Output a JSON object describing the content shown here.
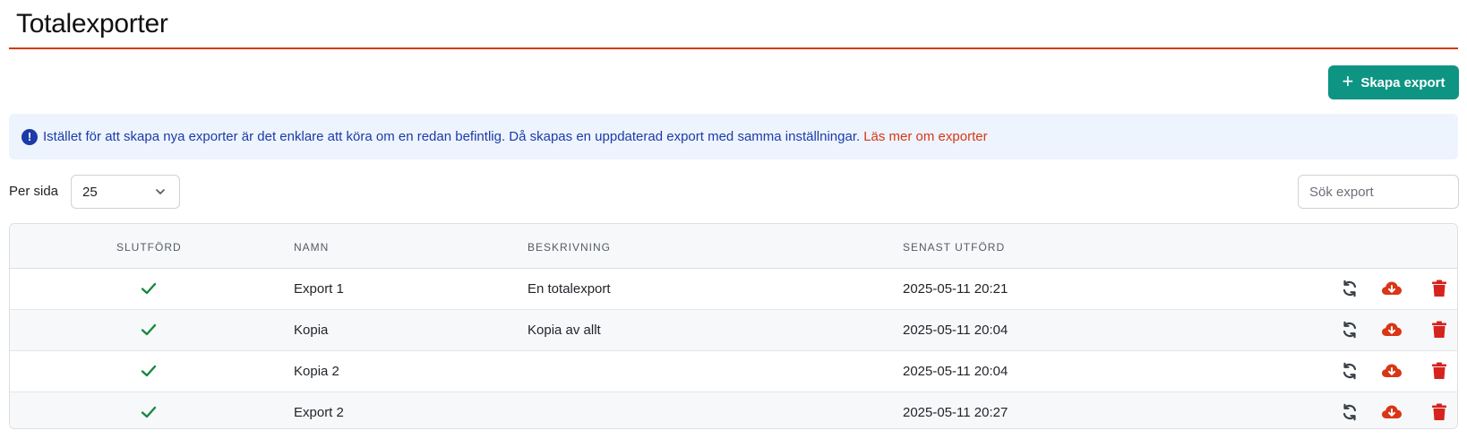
{
  "header": {
    "title": "Totalexporter"
  },
  "toolbar": {
    "create_label": "Skapa export"
  },
  "info": {
    "message": "Istället för att skapa nya exporter är det enklare att köra om en redan befintlig. Då skapas en uppdaterad export med samma inställningar.",
    "link_label": "Läs mer om exporter"
  },
  "controls": {
    "per_page_label": "Per sida",
    "per_page_value": "25",
    "search_placeholder": "Sök export"
  },
  "table": {
    "columns": {
      "completed": "SLUTFÖRD",
      "name": "NAMN",
      "description": "BESKRIVNING",
      "last_run": "SENAST UTFÖRD"
    },
    "rows": [
      {
        "name": "Export 1",
        "description": "En totalexport",
        "last_run": "2025-05-11 20:21",
        "completed": true
      },
      {
        "name": "Kopia",
        "description": "Kopia av allt",
        "last_run": "2025-05-11 20:04",
        "completed": true
      },
      {
        "name": "Kopia 2",
        "description": "",
        "last_run": "2025-05-11 20:04",
        "completed": true
      },
      {
        "name": "Export 2",
        "description": "",
        "last_run": "2025-05-11 20:27",
        "completed": true
      }
    ]
  },
  "colors": {
    "accent": "#0e9483",
    "title_rule": "#d93616",
    "info_text": "#1c3ba8",
    "info_bg": "#edf4fe",
    "check": "#16883f",
    "download": "#d93616",
    "delete": "#d6231e"
  },
  "icons": {
    "create": "plus-icon",
    "info": "exclamation-circle-icon",
    "completed": "check-icon",
    "rerun": "refresh-icon",
    "download": "cloud-download-icon",
    "delete": "trash-icon"
  }
}
